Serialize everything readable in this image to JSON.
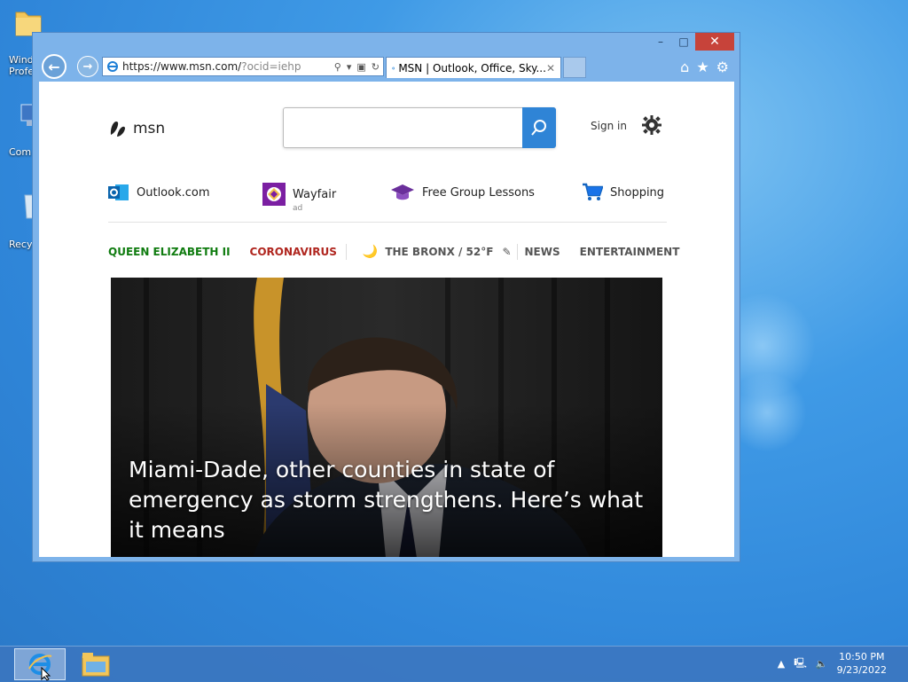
{
  "desktop": {
    "icons": [
      {
        "label": "Wind\nProfe"
      },
      {
        "label": "Com"
      },
      {
        "label": "Recy"
      }
    ]
  },
  "window": {
    "controls": {
      "minimize": "–",
      "maximize": "□",
      "close": "✕"
    }
  },
  "browser": {
    "back_icon": "arrow-left-icon",
    "forward_icon": "arrow-right-icon",
    "address": {
      "host": "https://www.msn.com/",
      "query": "?ocid=iehp"
    },
    "tab": {
      "title": "MSN | Outlook, Office, Sky...",
      "close": "✕"
    },
    "toolbar_icons": [
      "home-icon",
      "star-icon",
      "gear-icon"
    ]
  },
  "msn": {
    "logo_text": "msn",
    "search": {
      "value": "",
      "placeholder": ""
    },
    "signin": "Sign in",
    "links": [
      {
        "label": "Outlook.com"
      },
      {
        "label": "Wayfair",
        "badge": "ad"
      },
      {
        "label": "Free Group Lessons"
      },
      {
        "label": "Shopping"
      }
    ],
    "categories": {
      "queen": "QUEEN ELIZABETH II",
      "corona": "CORONAVIRUS",
      "weather": "THE BRONX / 52°F",
      "news": "NEWS",
      "entertainment": "ENTERTAINMENT"
    },
    "colors": {
      "queen": "#107c10",
      "corona": "#b0261f",
      "muted": "#555555",
      "accent": "#2f84d6"
    },
    "hero": {
      "title": "Miami-Dade, other counties in state of emergency as storm strengthens. Here’s what it means"
    }
  },
  "taskbar": {
    "apps": [
      "internet-explorer",
      "file-explorer"
    ],
    "clock": {
      "time": "10:50 PM",
      "date": "9/23/2022"
    }
  }
}
